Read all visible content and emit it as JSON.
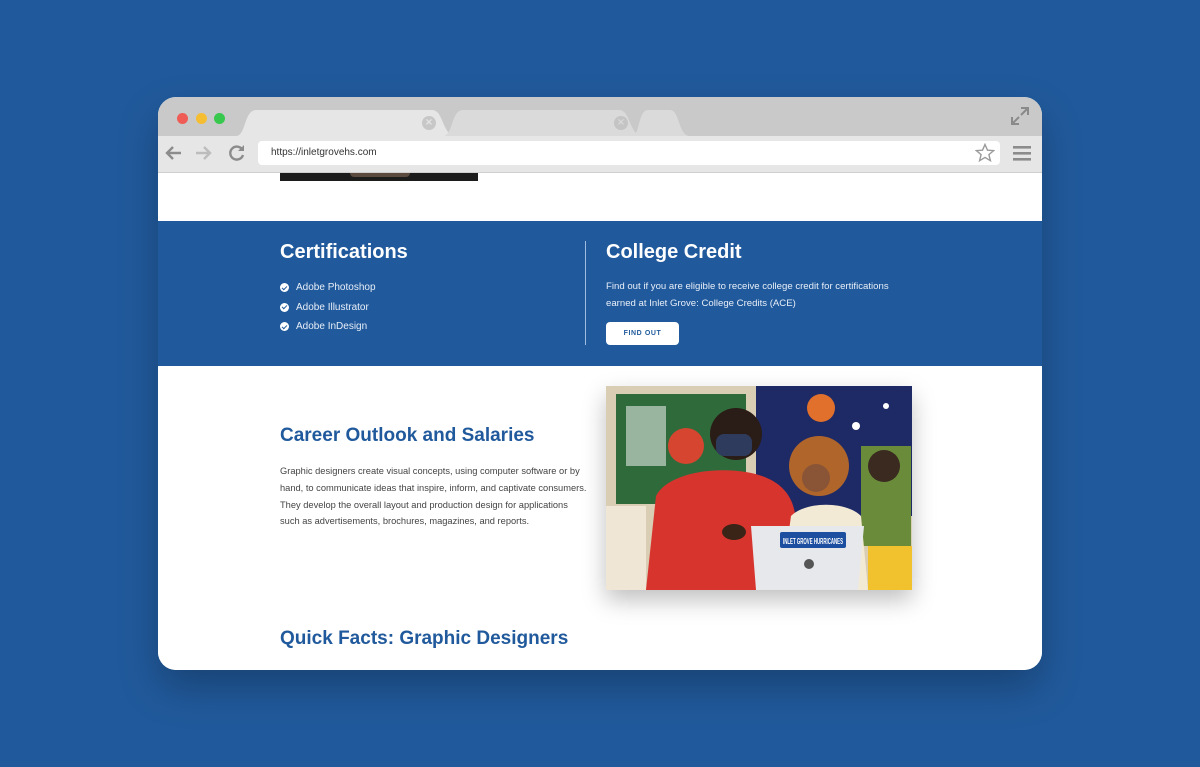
{
  "browser": {
    "url": "https://inletgrovehs.com"
  },
  "certifications": {
    "title": "Certifications",
    "items": [
      "Adobe Photoshop",
      "Adobe Illustrator",
      "Adobe InDesign"
    ]
  },
  "college_credit": {
    "title": "College Credit",
    "description": "Find out if you are eligible to receive college credit for certifications earned at Inlet Grove: College Credits (ACE)",
    "button_label": "FIND OUT"
  },
  "career": {
    "title": "Career Outlook and Salaries",
    "description": "Graphic designers create visual concepts, using computer software or by hand, to communicate ideas that inspire, inform, and captivate consumers. They develop the overall layout and production design for applications such as advertisements, brochures, magazines, and reports.",
    "photo_sticker_text": "INLET GROVE HURRICANES"
  },
  "quick_facts": {
    "title": "Quick Facts: Graphic Designers"
  },
  "colors": {
    "brand_blue": "#215a9c",
    "chrome_gray": "#c9c9c9"
  }
}
